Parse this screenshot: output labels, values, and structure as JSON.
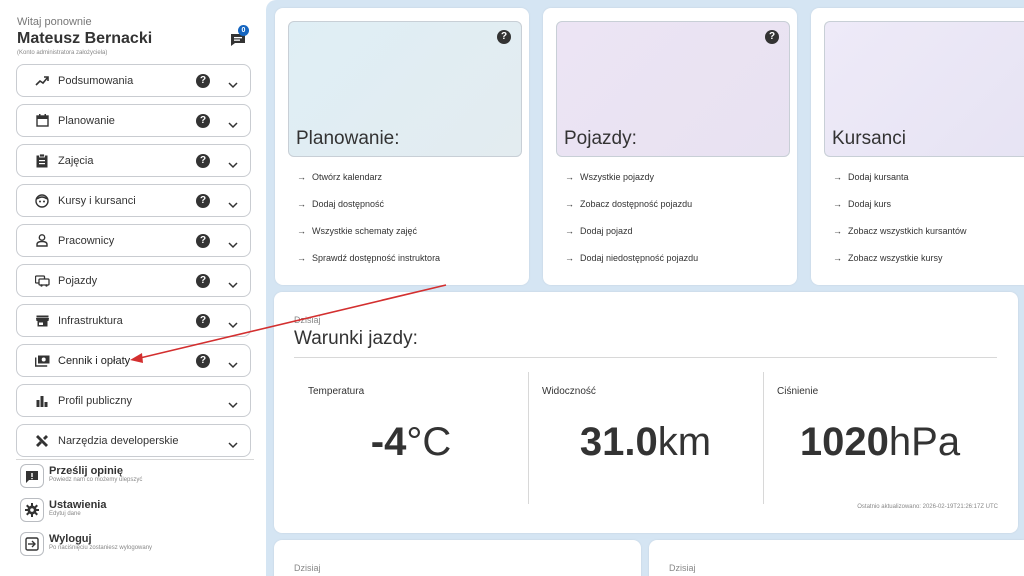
{
  "sidebar": {
    "greeting": "Witaj ponownie",
    "user_name": "Mateusz Bernacki",
    "user_sub": "(Konto administratora założyciela)",
    "chat_badge": "0",
    "nav": [
      {
        "label": "Podsumowania",
        "icon": "trending-up-icon",
        "help": true
      },
      {
        "label": "Planowanie",
        "icon": "calendar-icon",
        "help": true
      },
      {
        "label": "Zajęcia",
        "icon": "clipboard-icon",
        "help": true
      },
      {
        "label": "Kursy i kursanci",
        "icon": "face-icon",
        "help": true
      },
      {
        "label": "Pracownicy",
        "icon": "person-icon",
        "help": true
      },
      {
        "label": "Pojazdy",
        "icon": "car-icon",
        "help": true
      },
      {
        "label": "Infrastruktura",
        "icon": "store-icon",
        "help": true
      },
      {
        "label": "Cennik i opłaty",
        "icon": "payments-icon",
        "help": true
      },
      {
        "label": "Profil publiczny",
        "icon": "bar-chart-icon",
        "help": false
      },
      {
        "label": "Narzędzia developerskie",
        "icon": "tools-icon",
        "help": false
      }
    ],
    "help_symbol": "?",
    "footer": [
      {
        "title": "Prześlij opinię",
        "sub": "Powiedz nam co możemy ulepszyć",
        "icon": "feedback-icon"
      },
      {
        "title": "Ustawienia",
        "sub": "Edytuj dane",
        "icon": "gear-icon"
      },
      {
        "title": "Wyloguj",
        "sub": "Po naciśnięciu zostaniesz wylogowany",
        "icon": "logout-icon"
      }
    ]
  },
  "quick_cards": [
    {
      "title": "Planowanie:",
      "gradient": [
        "#dfeef5",
        "#e3ecf0"
      ],
      "help": true,
      "links": [
        "Otwórz kalendarz",
        "Dodaj dostępność",
        "Wszystkie schematy zajęć",
        "Sprawdź dostępność instruktora"
      ]
    },
    {
      "title": "Pojazdy:",
      "gradient": [
        "#ece4f4",
        "#e8e2f1"
      ],
      "help": true,
      "links": [
        "Wszystkie pojazdy",
        "Zobacz dostępność pojazdu",
        "Dodaj pojazd",
        "Dodaj niedostępność pojazdu"
      ]
    },
    {
      "title": "Kursanci",
      "gradient": [
        "#eeeaf8",
        "#e6e3f3"
      ],
      "help": false,
      "links": [
        "Dodaj kursanta",
        "Dodaj kurs",
        "Zobacz wszystkich kursantów",
        "Zobacz wszystkie kursy"
      ]
    }
  ],
  "link_arrow": "→",
  "weather": {
    "today": "Dzisiaj",
    "title": "Warunki jazdy:",
    "columns": [
      {
        "label": "Temperatura",
        "value": "-4",
        "unit": "°C"
      },
      {
        "label": "Widoczność",
        "value": "31.0",
        "unit": "km"
      },
      {
        "label": "Ciśnienie",
        "value": "1020",
        "unit": "hPa"
      }
    ],
    "updated": "Ostatnio aktualizowano: 2026-02-19T21:26:17Z UTC"
  },
  "bottom_cards": [
    "Dzisiaj",
    "Dzisiaj"
  ],
  "colors": {
    "main_bg": "#d5e5f3",
    "badge": "#1565c0",
    "annotation_arrow": "#d32f2f"
  }
}
